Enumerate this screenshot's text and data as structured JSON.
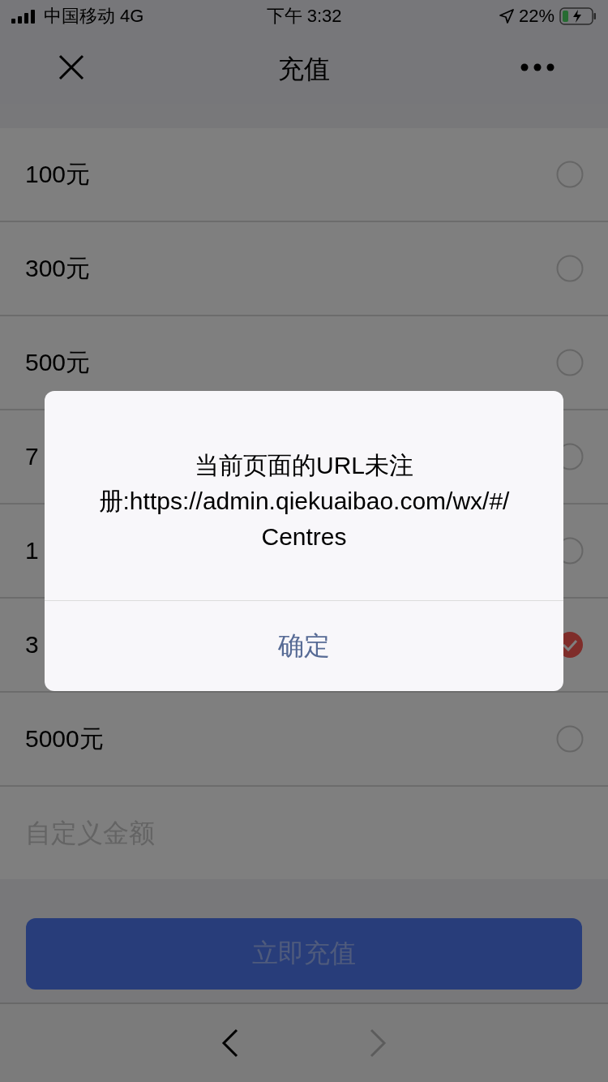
{
  "status_bar": {
    "carrier": "中国移动",
    "network": "4G",
    "time": "下午 3:32",
    "battery": "22%"
  },
  "nav": {
    "title": "充值"
  },
  "amounts": [
    {
      "label": "100元",
      "selected": false
    },
    {
      "label": "300元",
      "selected": false
    },
    {
      "label": "500元",
      "selected": false
    },
    {
      "label": "7",
      "selected": false
    },
    {
      "label": "1",
      "selected": false
    },
    {
      "label": "3",
      "selected": true
    },
    {
      "label": "5000元",
      "selected": false
    }
  ],
  "custom_amount": {
    "placeholder": "自定义金额"
  },
  "pay_button": {
    "label": "立即充值",
    "disabled": true
  },
  "toolbar": {
    "back_disabled": false,
    "forward_disabled": true
  },
  "dialog": {
    "message": "当前页面的URL未注册:https://admin.qiekuaibao.com/wx/#/Centres",
    "button": "确定"
  }
}
